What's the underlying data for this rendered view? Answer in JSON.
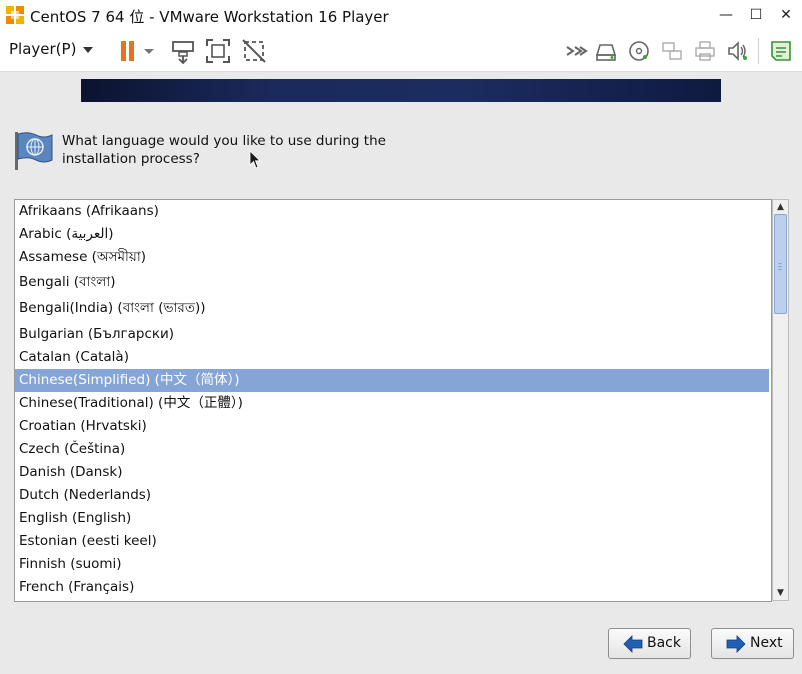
{
  "window": {
    "title": "CentOS 7 64 位 - VMware Workstation 16 Player",
    "controls": {
      "minimize": "—",
      "maximize": "☐",
      "close": "✕"
    }
  },
  "toolbar": {
    "player_menu": "Player(P)",
    "icons": [
      "pause-icon",
      "dropdown-icon",
      "send-ctrl-alt-del-icon",
      "fullscreen-icon",
      "unity-icon",
      "more-devices-icon",
      "hard-disk-icon",
      "cd-dvd-icon",
      "network-icon",
      "printer-icon",
      "sound-icon",
      "message-log-icon"
    ]
  },
  "installer": {
    "question_line1": "What language would you like to use during the",
    "question_line2": "installation process?",
    "selected_index": 7,
    "languages": [
      "Afrikaans (Afrikaans)",
      "Arabic (العربية)",
      "Assamese (অসমীয়া)",
      "Bengali (বাংলা)",
      "Bengali(India) (বাংলা (ভারত))",
      "Bulgarian (Български)",
      "Catalan (Català)",
      "Chinese(Simplified) (中文（简体）)",
      "Chinese(Traditional) (中文（正體）)",
      "Croatian (Hrvatski)",
      "Czech (Čeština)",
      "Danish (Dansk)",
      "Dutch (Nederlands)",
      "English (English)",
      "Estonian (eesti keel)",
      "Finnish (suomi)",
      "French (Français)"
    ],
    "back_label": "Back",
    "next_label": "Next"
  },
  "colors": {
    "selection": "#85a5d6",
    "pause": "#e8731f",
    "arrow": "#1f5fb4"
  }
}
